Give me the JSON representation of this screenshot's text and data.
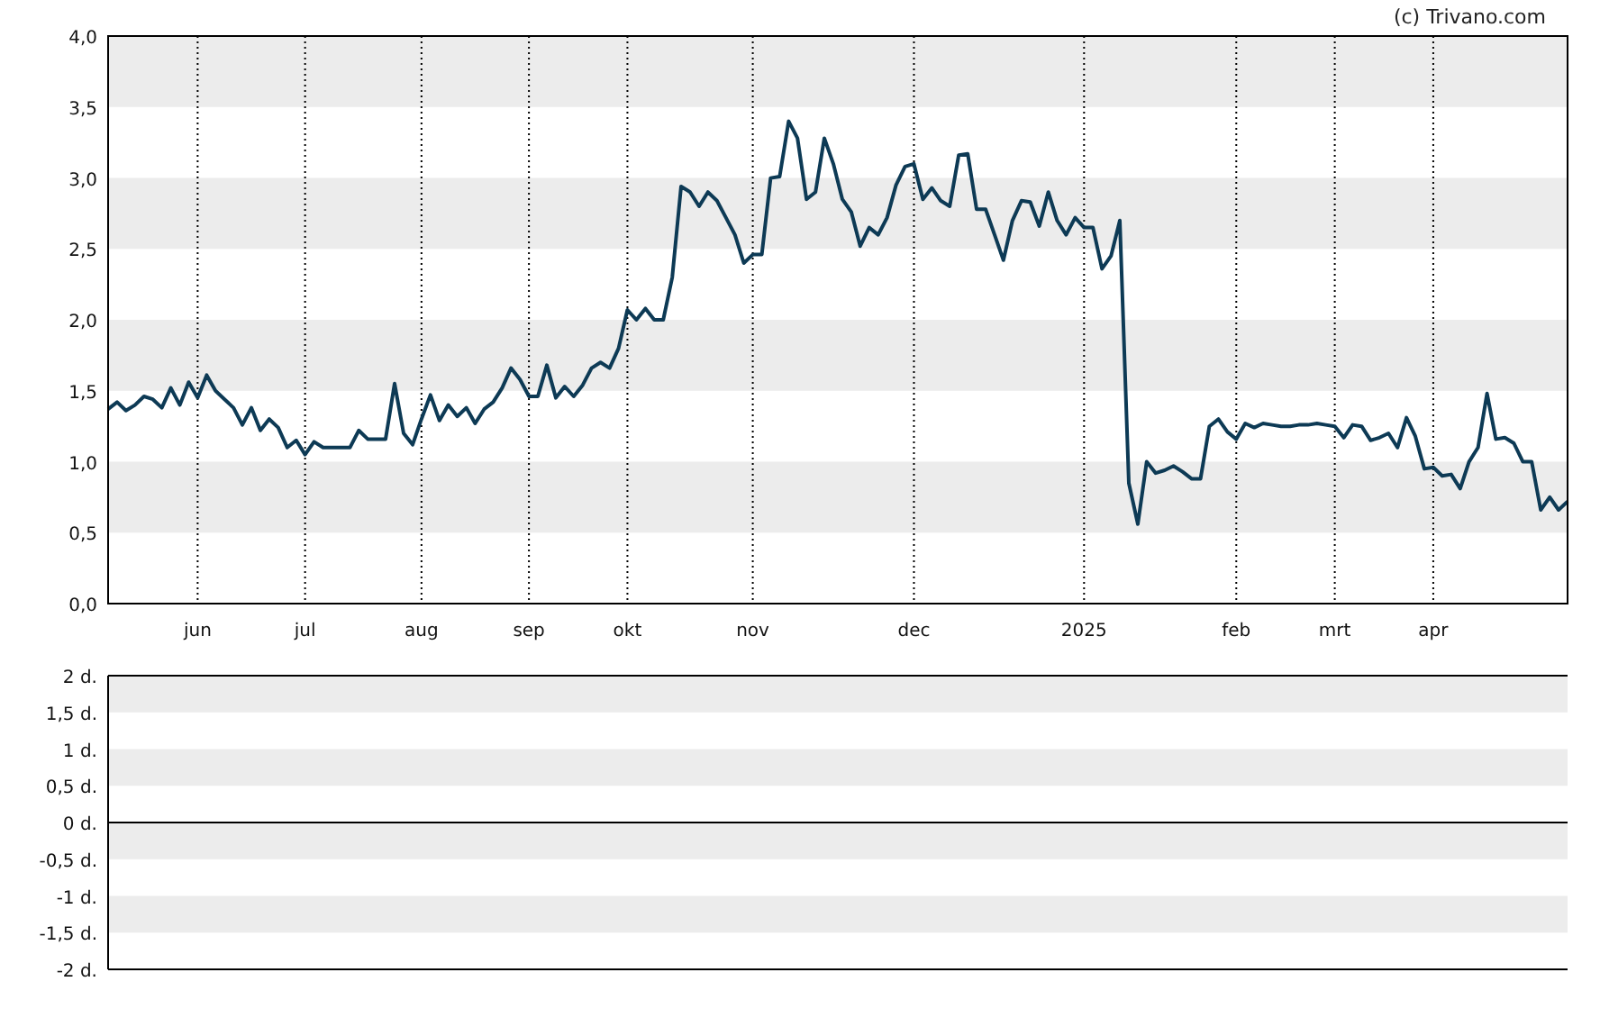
{
  "credit": "(c) Trivano.com",
  "price_chart": {
    "chart_data": {
      "type": "line",
      "categories": [
        null,
        null,
        null,
        null,
        null,
        null,
        null,
        null,
        null,
        null,
        "jun",
        null,
        null,
        null,
        null,
        null,
        null,
        null,
        null,
        null,
        null,
        null,
        "jul",
        null,
        null,
        null,
        null,
        null,
        null,
        null,
        null,
        null,
        null,
        null,
        null,
        "aug",
        null,
        null,
        null,
        null,
        null,
        null,
        null,
        null,
        null,
        null,
        null,
        "sep",
        null,
        null,
        null,
        null,
        null,
        null,
        null,
        null,
        null,
        null,
        "okt",
        null,
        null,
        null,
        null,
        null,
        null,
        null,
        null,
        null,
        null,
        null,
        null,
        null,
        "nov",
        null,
        null,
        null,
        null,
        null,
        null,
        null,
        null,
        null,
        null,
        null,
        null,
        null,
        null,
        null,
        null,
        null,
        "dec",
        null,
        null,
        null,
        null,
        null,
        null,
        null,
        null,
        null,
        null,
        null,
        null,
        null,
        null,
        null,
        null,
        null,
        null,
        "2025",
        null,
        null,
        null,
        null,
        null,
        null,
        null,
        null,
        null,
        null,
        null,
        null,
        null,
        null,
        null,
        null,
        "feb",
        null,
        null,
        null,
        null,
        null,
        null,
        null,
        null,
        null,
        null,
        "mrt",
        null,
        null,
        null,
        null,
        null,
        null,
        null,
        null,
        null,
        null,
        "apr",
        null,
        null,
        null,
        null,
        null,
        null,
        null,
        null,
        null,
        null,
        null,
        null,
        null,
        null,
        null
      ],
      "series": [
        {
          "color": "#0d3a55",
          "values": [
            1.37,
            1.42,
            1.36,
            1.4,
            1.46,
            1.44,
            1.38,
            1.52,
            1.4,
            1.56,
            1.45,
            1.61,
            1.5,
            1.44,
            1.38,
            1.26,
            1.38,
            1.22,
            1.3,
            1.24,
            1.1,
            1.15,
            1.05,
            1.14,
            1.1,
            1.1,
            1.1,
            1.1,
            1.22,
            1.16,
            1.16,
            1.16,
            1.55,
            1.2,
            1.12,
            1.3,
            1.47,
            1.29,
            1.4,
            1.32,
            1.38,
            1.27,
            1.37,
            1.42,
            1.52,
            1.66,
            1.58,
            1.46,
            1.46,
            1.68,
            1.45,
            1.53,
            1.46,
            1.54,
            1.66,
            1.7,
            1.66,
            1.8,
            2.07,
            2.0,
            2.08,
            2.0,
            2.0,
            2.3,
            2.94,
            2.9,
            2.8,
            2.9,
            2.84,
            2.72,
            2.6,
            2.4,
            2.46,
            2.46,
            3.0,
            3.01,
            3.4,
            3.28,
            2.85,
            2.9,
            3.28,
            3.1,
            2.85,
            2.76,
            2.52,
            2.65,
            2.6,
            2.72,
            2.95,
            3.08,
            3.1,
            2.85,
            2.93,
            2.84,
            2.8,
            3.16,
            3.17,
            2.78,
            2.78,
            2.6,
            2.42,
            2.7,
            2.84,
            2.83,
            2.66,
            2.9,
            2.7,
            2.6,
            2.72,
            2.65,
            2.65,
            2.36,
            2.45,
            2.7,
            0.85,
            0.56,
            1.0,
            0.92,
            0.94,
            0.97,
            0.93,
            0.88,
            0.88,
            1.25,
            1.3,
            1.21,
            1.16,
            1.27,
            1.24,
            1.27,
            1.26,
            1.25,
            1.25,
            1.26,
            1.26,
            1.27,
            1.26,
            1.25,
            1.17,
            1.26,
            1.25,
            1.15,
            1.17,
            1.2,
            1.1,
            1.31,
            1.18,
            0.95,
            0.96,
            0.9,
            0.91,
            0.81,
            1.0,
            1.1,
            1.48,
            1.16,
            1.17,
            1.13,
            1.0,
            1.0,
            0.66,
            0.75,
            0.66,
            0.72
          ]
        }
      ],
      "ylim": [
        0,
        4
      ],
      "yticks": [
        {
          "value": 0,
          "label": "0,0"
        },
        {
          "value": 0.5,
          "label": "0,5"
        },
        {
          "value": 1,
          "label": "1,0"
        },
        {
          "value": 1.5,
          "label": "1,5"
        },
        {
          "value": 2,
          "label": "2,0"
        },
        {
          "value": 2.5,
          "label": "2,5"
        },
        {
          "value": 3,
          "label": "3,0"
        },
        {
          "value": 3.5,
          "label": "3,5"
        },
        {
          "value": 4,
          "label": "4,0"
        }
      ]
    }
  },
  "lower_panel": {
    "axis_labels": [
      "2 d.",
      "1,5 d.",
      "1 d.",
      "0,5 d.",
      "0 d.",
      "-0,5 d.",
      "-1 d.",
      "-1,5 d.",
      "-2 d."
    ]
  }
}
